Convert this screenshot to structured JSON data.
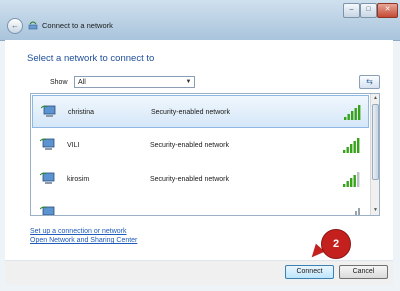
{
  "window": {
    "title": "Connect to a network",
    "controls": {
      "minimize": "–",
      "maximize": "□",
      "close": "✕"
    },
    "back_icon": "←"
  },
  "heading": "Select a network to connect to",
  "filter": {
    "label": "Show",
    "selected": "All"
  },
  "networks": [
    {
      "name": "christina",
      "security": "Security-enabled network",
      "selected": true,
      "signal_bars": 5
    },
    {
      "name": "VILI",
      "security": "Security-enabled network",
      "selected": false,
      "signal_bars": 5
    },
    {
      "name": "kirosim",
      "security": "Security-enabled network",
      "selected": false,
      "signal_bars": 4
    }
  ],
  "links": {
    "setup": "Set up a connection or network",
    "sharing_center": "Open Network and Sharing Center"
  },
  "buttons": {
    "connect": "Connect",
    "cancel": "Cancel"
  },
  "annotation": {
    "step": "2"
  },
  "colors": {
    "accent": "#1f4e99",
    "signal": "#37a319",
    "badge": "#c4211e"
  },
  "icons": {
    "network": "network-computer-icon",
    "signal": "signal-strength-icon",
    "refresh": "refresh-icon"
  }
}
